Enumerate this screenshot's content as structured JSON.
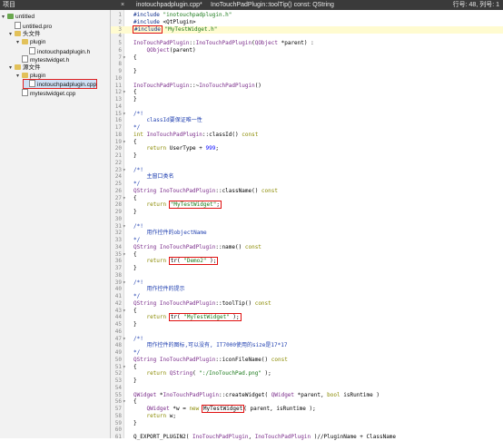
{
  "topbar": {
    "project_label": "项目",
    "file_tab": "inotouchpadplugin.cpp*",
    "close_icon": "×",
    "function_crumb": "InoTouchPadPlugin::toolTip() const: QString",
    "position": "行号: 48, 列号: 1"
  },
  "tree": [
    {
      "label": "untitled",
      "type": "project",
      "level": 0,
      "expanded": true
    },
    {
      "label": "untitled.pro",
      "type": "file",
      "level": 1
    },
    {
      "label": "头文件",
      "type": "folder",
      "level": 1,
      "expanded": true
    },
    {
      "label": "plugin",
      "type": "folder",
      "level": 2,
      "expanded": true
    },
    {
      "label": "inotouchpadplugin.h",
      "type": "file",
      "level": 3
    },
    {
      "label": "mytestwidget.h",
      "type": "file",
      "level": 2
    },
    {
      "label": "源文件",
      "type": "folder",
      "level": 1,
      "expanded": true
    },
    {
      "label": "plugin",
      "type": "folder",
      "level": 2,
      "expanded": true
    },
    {
      "label": "inotouchpadplugin.cpp",
      "type": "file",
      "level": 3,
      "selected": true
    },
    {
      "label": "mytestwidget.cpp",
      "type": "file",
      "level": 2
    }
  ],
  "code": {
    "line_numbers": [
      "1",
      "2",
      "3",
      "4",
      "5",
      "6",
      "7",
      "8",
      "9",
      "10",
      "11",
      "12",
      "13",
      "14",
      "15",
      "16",
      "17",
      "18",
      "19",
      "20",
      "21",
      "22",
      "23",
      "24",
      "25",
      "26",
      "27",
      "28",
      "29",
      "30",
      "31",
      "32",
      "33",
      "34",
      "35",
      "36",
      "37",
      "38",
      "39",
      "40",
      "41",
      "42",
      "43",
      "44",
      "45",
      "46",
      "47",
      "48",
      "49",
      "50",
      "51",
      "52",
      "53",
      "54",
      "55",
      "56",
      "57",
      "58",
      "59",
      "60",
      "61"
    ],
    "lines": [
      "#include \"inotouchpadplugin.h\"",
      "#include <QtPlugin>",
      "#include \"MyTestWidget.h\"",
      "",
      "InoTouchPadPlugin::InoTouchPadPlugin(QObject *parent) :",
      "    QObject(parent)",
      "{",
      "",
      "}",
      "",
      "InoTouchPadPlugin::~InoTouchPadPlugin()",
      "{",
      "}",
      "",
      "/*!",
      "    classId要保证唯一性",
      "*/",
      "int InoTouchPadPlugin::classId() const",
      "{",
      "    return UserType + 999;",
      "}",
      "",
      "/*!",
      "    主窗口类名",
      "*/",
      "QString InoTouchPadPlugin::className() const",
      "{",
      "    return \"MyTestWidget\";",
      "}",
      "",
      "/*!",
      "    用作控件的objectName",
      "*/",
      "QString InoTouchPadPlugin::name() const",
      "{",
      "    return tr( \"Demo2\" );",
      "}",
      "",
      "/*!",
      "    用作控件的提示",
      "*/",
      "QString InoTouchPadPlugin::toolTip() const",
      "{",
      "    return tr( \"MyTestWidget\" );",
      "}",
      "",
      "/*!",
      "    用作控件的图标,可以没有, IT7000使用的size是17*17",
      "*/",
      "QString InoTouchPadPlugin::iconFileName() const",
      "{",
      "    return QString( \":/InoTouchPad.png\" );",
      "}",
      "",
      "QWidget *InoTouchPadPlugin::createWidget( QWidget *parent, bool isRuntime )",
      "{",
      "    QWidget *w = new MyTestWidget( parent, isRuntime );",
      "    return w;",
      "}",
      "",
      "Q_EXPORT_PLUGIN2( InoTouchPadPlugin, InoTouchPadPlugin )//PluginName + ClassName"
    ]
  }
}
